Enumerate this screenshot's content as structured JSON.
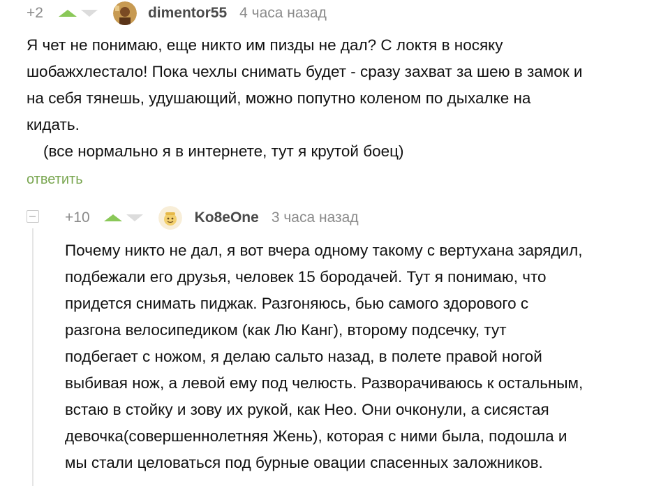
{
  "comment1": {
    "rating": "+2",
    "username": "dimentor55",
    "time": "4 часа назад",
    "lines": [
      "Я чет не понимаю, еще никто им пизды не дал? С локтя в носяку",
      "шобажхлестало! Пока чехлы снимать будет - сразу захват за шею в замок и",
      "на себя тянешь, удушающий, можно попутно коленом по дыхалке на",
      "кидать.",
      "(все нормально я в интернете, тут я крутой боец)"
    ],
    "reply_label": "ответить"
  },
  "comment2": {
    "rating": "+10",
    "username": "Ko8eOne",
    "time": "3 часа назад",
    "lines": [
      "Почему никто  не дал, я вот вчера одному такому  с вертухана зарядил,",
      "подбежали его друзья, человек 15 бородачей. Тут я понимаю, что",
      "придется снимать пиджак. Разгоняюсь, бью самого здорового с",
      "разгона велосипедиком (как Лю Канг), второму подсечку, тут",
      "подбегает с ножом, я делаю сальто назад, в полете правой ногой",
      "выбивая нож, а левой ему под челюсть. Разворачиваюсь к остальным,",
      "встаю в стойку и зову их рукой, как Нео. Они очконули, а сисястая",
      "девочка(совершеннолетняя Жень), которая с ними была, подошла и",
      "мы стали целоваться под бурные овации спасенных заложников."
    ]
  },
  "icons": {
    "upvote": "upvote-arrow-icon",
    "downvote": "downvote-arrow-icon",
    "collapse": "collapse-minus-icon"
  },
  "colors": {
    "upvote": "#8ac858",
    "downvote": "#dcdcdc",
    "reply_link": "#79a650",
    "meta_text": "#8a8a8a"
  }
}
